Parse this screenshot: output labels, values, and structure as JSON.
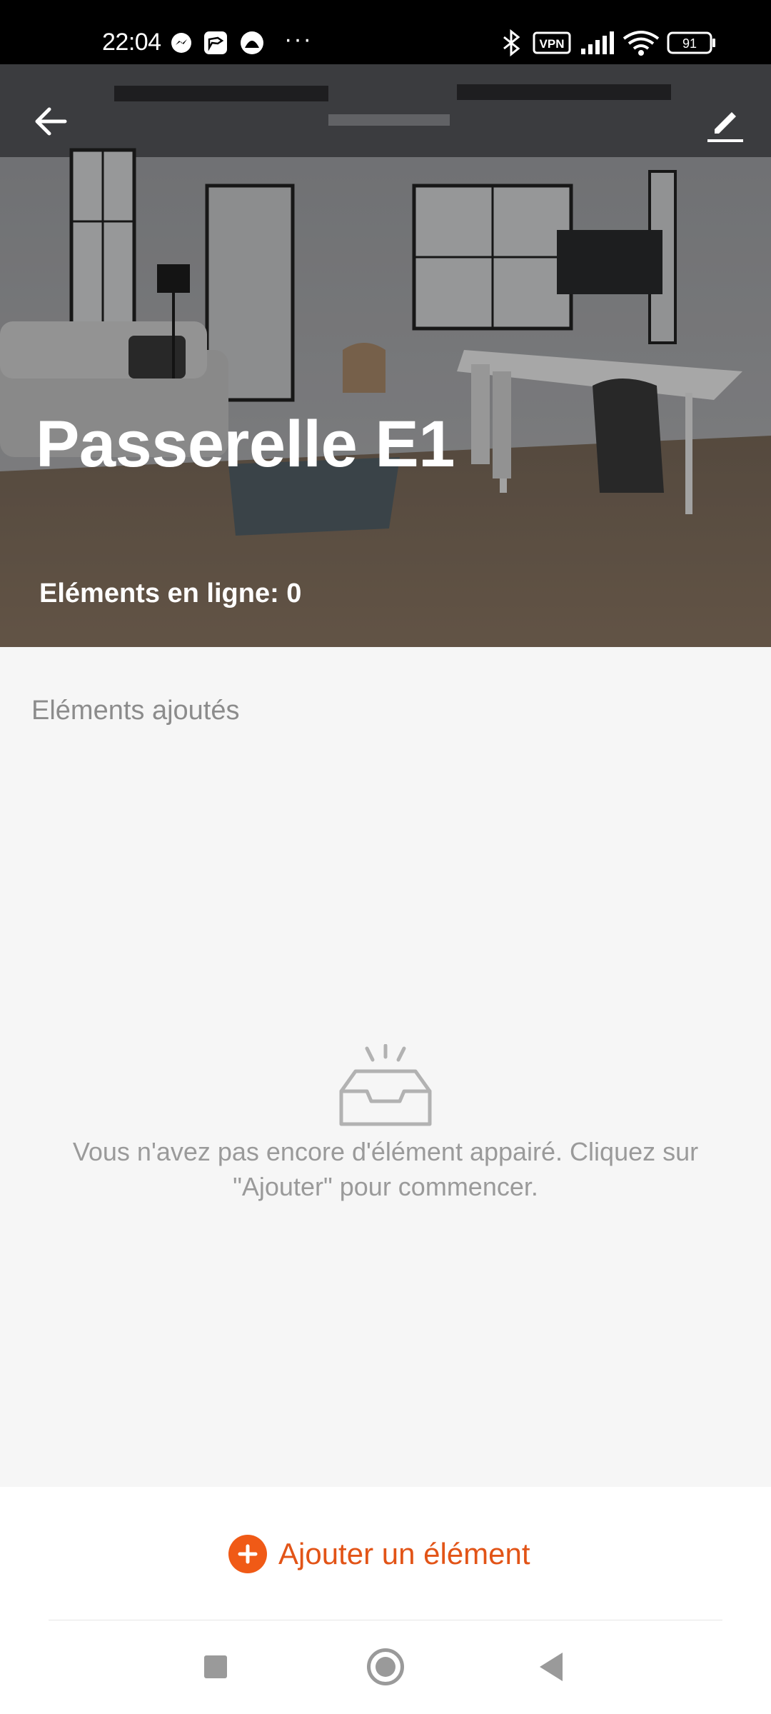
{
  "status_bar": {
    "time": "22:04",
    "notification_icons": [
      "messenger-icon",
      "app-notification-icon",
      "app-notification-icon-2"
    ],
    "more_indicator": "···",
    "right_icons": [
      "bluetooth-icon",
      "vpn-icon",
      "signal-icon",
      "wifi-icon",
      "battery-icon"
    ],
    "vpn_label": "VPN",
    "battery_level": "91"
  },
  "header": {
    "back_icon": "back-arrow-icon",
    "edit_icon": "pencil-edit-icon",
    "title": "Passerelle E1",
    "online_count": "Eléments en ligne: 0"
  },
  "main": {
    "section_title": "Eléments ajoutés",
    "empty_state": {
      "icon": "empty-inbox-icon",
      "message": "Vous n'avez pas encore  d'élément appairé. Cliquez sur \"Ajouter\" pour commencer."
    }
  },
  "footer": {
    "add_icon": "plus-circle-icon",
    "add_label": "Ajouter un élément"
  },
  "nav_bar": {
    "items": [
      "recents-square-icon",
      "home-circle-icon",
      "back-triangle-icon"
    ]
  },
  "colors": {
    "accent": "#f05a16",
    "accent_text": "#e25417",
    "background": "#f6f6f6"
  }
}
